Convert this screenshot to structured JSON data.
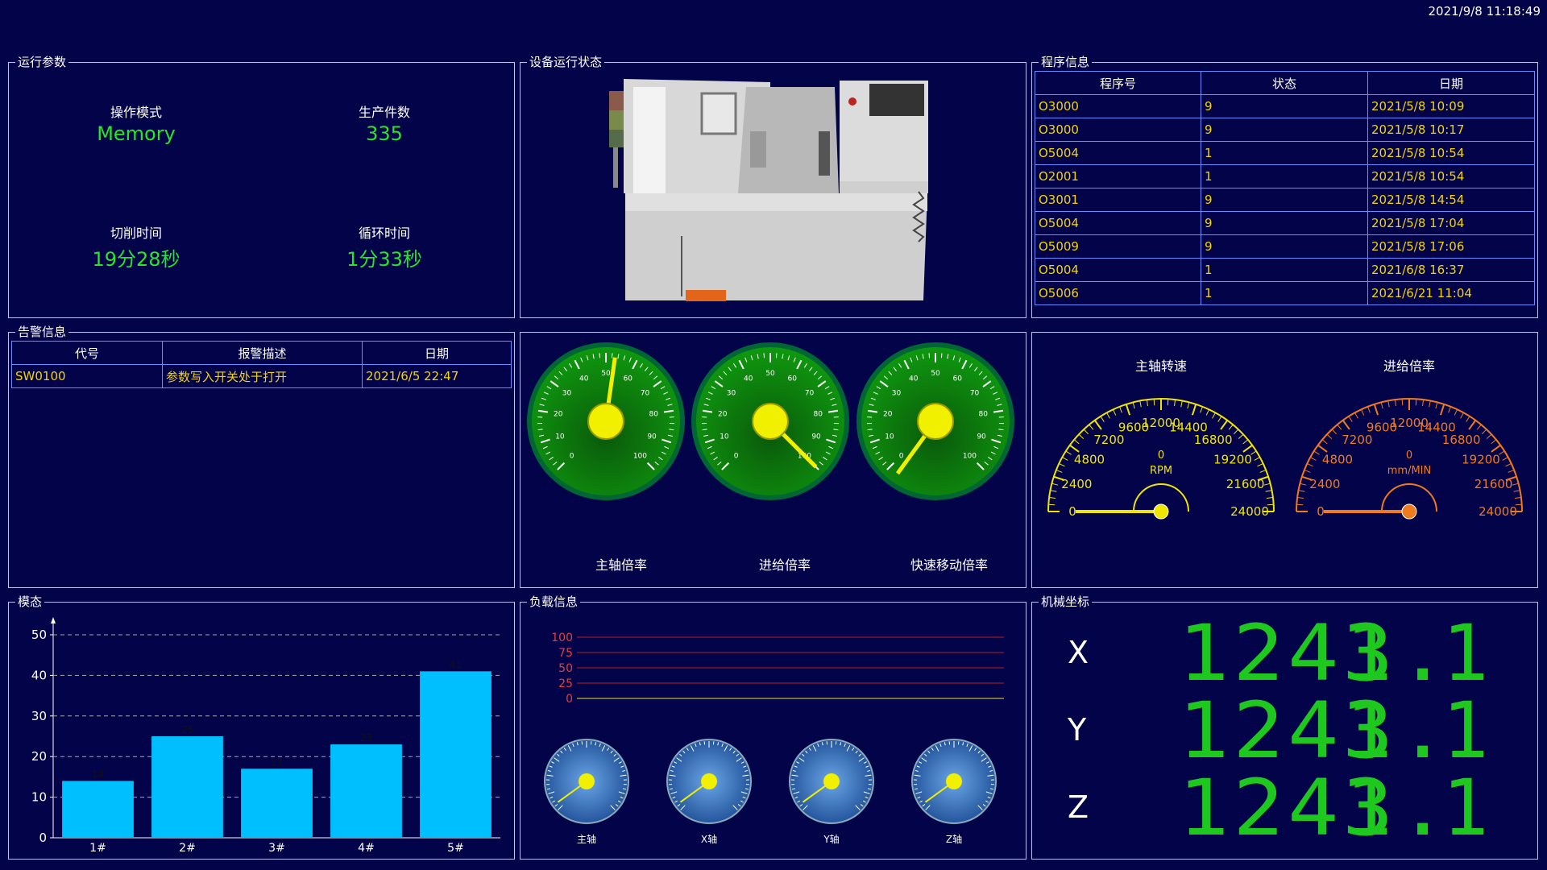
{
  "clock": "2021/9/8 11:18:49",
  "panels": {
    "run_params": "运行参数",
    "device_status": "设备运行状态",
    "program_info": "程序信息",
    "alarm_info": "告警信息",
    "mold": "模态",
    "load_info": "负载信息",
    "machine_coords": "机械坐标"
  },
  "params": [
    {
      "label": "操作模式",
      "value": "Memory"
    },
    {
      "label": "生产件数",
      "value": "335"
    },
    {
      "label": "切削时间",
      "value": "19分28秒"
    },
    {
      "label": "循环时间",
      "value": "1分33秒"
    }
  ],
  "program_table": {
    "headers": [
      "程序号",
      "状态",
      "日期"
    ],
    "rows": [
      [
        "O3000",
        "9",
        "2021/5/8 10:09"
      ],
      [
        "O3000",
        "9",
        "2021/5/8 10:17"
      ],
      [
        "O5004",
        "1",
        "2021/5/8 10:54"
      ],
      [
        "O2001",
        "1",
        "2021/5/8 10:54"
      ],
      [
        "O3001",
        "9",
        "2021/5/8 14:54"
      ],
      [
        "O5004",
        "9",
        "2021/5/8 17:04"
      ],
      [
        "O5009",
        "9",
        "2021/5/8 17:06"
      ],
      [
        "O5004",
        "1",
        "2021/6/8 16:37"
      ],
      [
        "O5006",
        "1",
        "2021/6/21 11:04"
      ]
    ]
  },
  "alarm_table": {
    "headers": [
      "代号",
      "报警描述",
      "日期"
    ],
    "rows": [
      [
        "SW0100",
        "参数写入开关处于打开",
        "2021/6/5 22:47"
      ]
    ]
  },
  "override_gauges": {
    "labels": [
      "主轴倍率",
      "进给倍率",
      "快速移动倍率"
    ],
    "values": [
      53,
      100,
      130
    ],
    "ticks": [
      "0",
      "10",
      "20",
      "30",
      "40",
      "50",
      "60",
      "70",
      "80",
      "90",
      "100"
    ]
  },
  "speed_gauges": [
    {
      "title": "主轴转速",
      "value": "0",
      "unit": "RPM",
      "color": "#f0e600",
      "ticks": [
        "0",
        "2400",
        "4800",
        "7200",
        "9600",
        "12000",
        "14400",
        "16800",
        "19200",
        "21600",
        "24000"
      ]
    },
    {
      "title": "进给倍率",
      "value": "0",
      "unit": "mm/MIN",
      "color": "#f07a1e",
      "ticks": [
        "0",
        "2400",
        "4800",
        "7200",
        "9600",
        "12000",
        "14400",
        "16800",
        "19200",
        "21600",
        "24000"
      ]
    }
  ],
  "load": {
    "ticks": [
      "100",
      "75",
      "50",
      "25",
      "0"
    ],
    "gauge_labels": [
      "主轴",
      "X轴",
      "Y轴",
      "Z轴"
    ]
  },
  "coords": {
    "axes": [
      "X",
      "Y",
      "Z"
    ],
    "value_a": "1243.",
    "value_b": "1111"
  },
  "chart_data": {
    "type": "bar",
    "categories": [
      "1#",
      "2#",
      "3#",
      "4#",
      "5#"
    ],
    "values": [
      14,
      25,
      17,
      23,
      41
    ],
    "yticks": [
      "0",
      "10",
      "20",
      "30",
      "40",
      "50"
    ],
    "ylim": [
      0,
      50
    ],
    "color": "#00bfff",
    "grid": true
  }
}
